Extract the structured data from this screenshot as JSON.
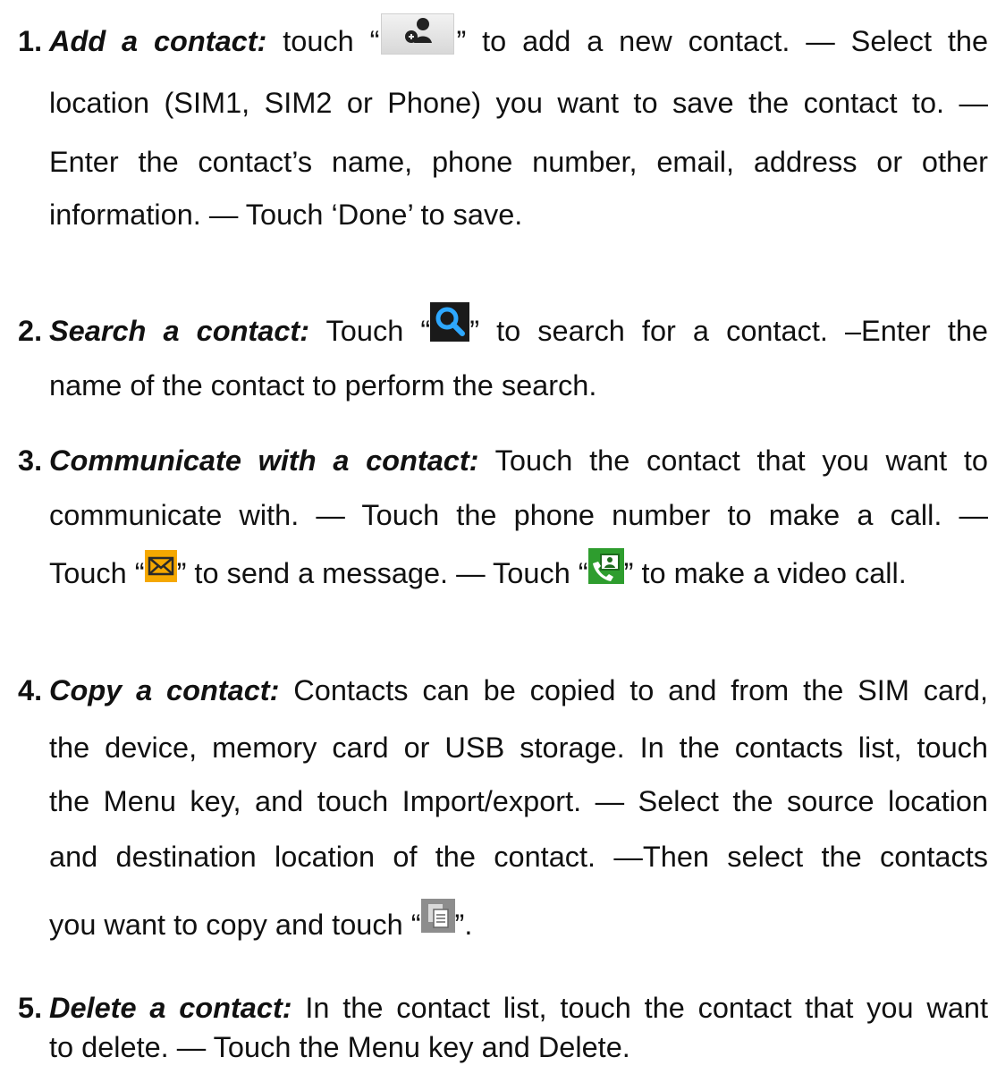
{
  "items": [
    {
      "number": "1.",
      "heading": "Add a contact:",
      "lines": [
        {
          "pre": "touch “",
          "icon": "add-contact-icon",
          "post": "” to add a new contact. — Select the"
        },
        {
          "text": "location (SIM1, SIM2 or Phone) you want to save the contact to. —"
        },
        {
          "text": "Enter the contact’s name, phone number, email, address or other"
        },
        {
          "text": "information. — Touch ‘Done’ to save."
        }
      ]
    },
    {
      "number": "2.",
      "heading": "Search a contact:",
      "lines": [
        {
          "pre": "Touch “",
          "icon": "search-icon",
          "post": "” to search for a contact. –Enter the"
        },
        {
          "text": "name of the contact to perform the search."
        }
      ]
    },
    {
      "number": "3.",
      "heading": "Communicate with a contact:",
      "lines": [
        {
          "post": "Touch the contact that you want to"
        },
        {
          "text": "communicate with. — Touch the phone number to make a call. —"
        },
        {
          "pre": "Touch “",
          "icon": "message-icon",
          "mid": "” to send a message. — Touch “",
          "icon2": "video-call-icon",
          "post": "” to make a video call."
        }
      ]
    },
    {
      "number": "4.",
      "heading": "Copy a contact:",
      "lines": [
        {
          "post": "Contacts can be copied to and from the SIM card,"
        },
        {
          "text": "the device, memory card or USB storage. In the contacts list, touch"
        },
        {
          "text": "the Menu key, and touch Import/export. — Select the source location"
        },
        {
          "text": "and destination location of the contact. —Then select the contacts"
        },
        {
          "pre": "you want to copy and touch “",
          "icon": "copy-icon",
          "post": "”."
        }
      ]
    },
    {
      "number": "5.",
      "heading": "Delete a contact:",
      "lines": [
        {
          "post": "In the contact list, touch the contact that you want"
        },
        {
          "text": "to delete. — Touch the Menu key and Delete."
        }
      ]
    }
  ]
}
